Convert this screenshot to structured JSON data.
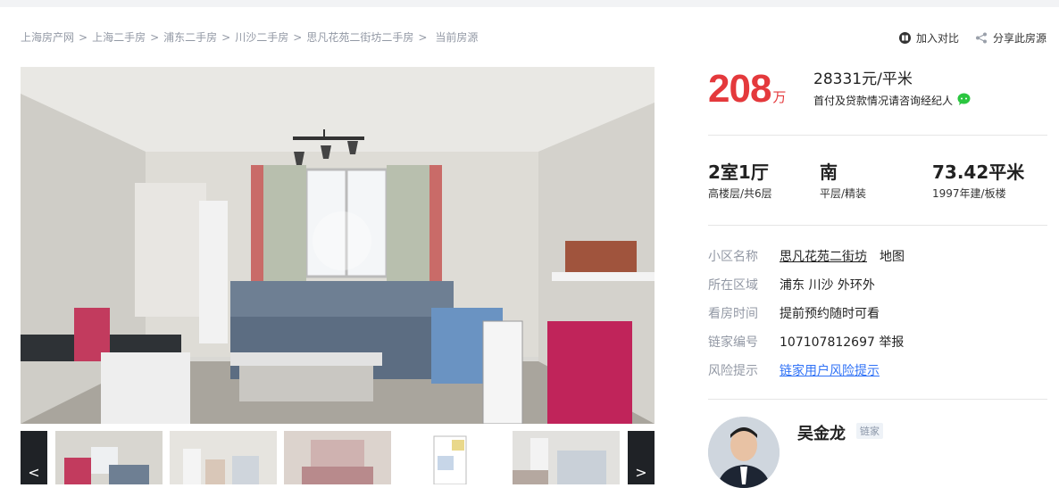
{
  "breadcrumb": {
    "items": [
      "上海房产网",
      "上海二手房",
      "浦东二手房",
      "川沙二手房",
      "思凡花苑二街坊二手房"
    ],
    "current": "当前房源",
    "separator": ">"
  },
  "actions": {
    "compare_label": "加入对比",
    "share_label": "分享此房源"
  },
  "gallery": {
    "prev_label": "<",
    "next_label": ">"
  },
  "price": {
    "total": "208",
    "total_unit": "万",
    "unit_price_num": "28331",
    "unit_price_suffix": "元/平米",
    "down_payment_note": "首付及贷款情况请咨询经纪人"
  },
  "attributes": [
    {
      "main": "2室1厅",
      "sub": "高楼层/共6层"
    },
    {
      "main": "南",
      "sub": "平层/精装"
    },
    {
      "main": "73.42平米",
      "sub": "1997年建/板楼"
    }
  ],
  "info": {
    "community_label": "小区名称",
    "community_value": "思凡花苑二街坊",
    "community_map": "地图",
    "area_label": "所在区域",
    "area_value": "浦东 川沙 外环外",
    "visit_label": "看房时间",
    "visit_value": "提前预约随时可看",
    "id_label": "链家编号",
    "id_value": "107107812697 举报",
    "risk_label": "风险提示",
    "risk_value": "链家用户风险提示"
  },
  "agent": {
    "name": "吴金龙",
    "badge": "链家"
  },
  "colors": {
    "price_red": "#e4393c",
    "link_blue": "#3072f6",
    "wechat_green": "#2bc640"
  }
}
